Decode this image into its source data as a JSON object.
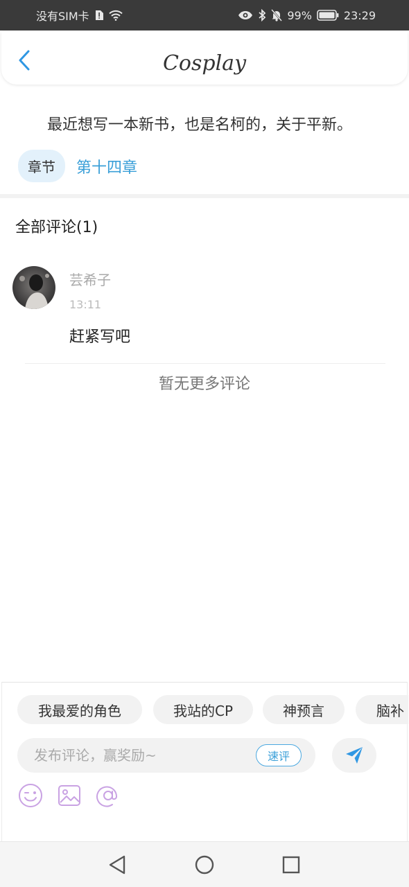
{
  "status_bar": {
    "carrier": "没有SIM卡",
    "battery": "99%",
    "time": "23:29"
  },
  "header": {
    "title": "Cosplay"
  },
  "post": {
    "intro": "最近想写一本新书，也是名柯的，关于平新。",
    "chapter_tag": "章节",
    "chapter_link": "第十四章"
  },
  "comments_section": {
    "title": "全部评论(1)",
    "items": [
      {
        "user": "芸希子",
        "time": "13:11",
        "text": "赶紧写吧"
      }
    ],
    "no_more": "暂无更多评论"
  },
  "composer": {
    "chips": [
      "我最爱的角色",
      "我站的CP",
      "神预言",
      "脑补"
    ],
    "placeholder": "发布评论，赢奖励~",
    "quick_label": "速评"
  },
  "colors": {
    "accent": "#3a9fd8",
    "tool_icon": "#c9a2e3",
    "send": "#2f97e3"
  }
}
